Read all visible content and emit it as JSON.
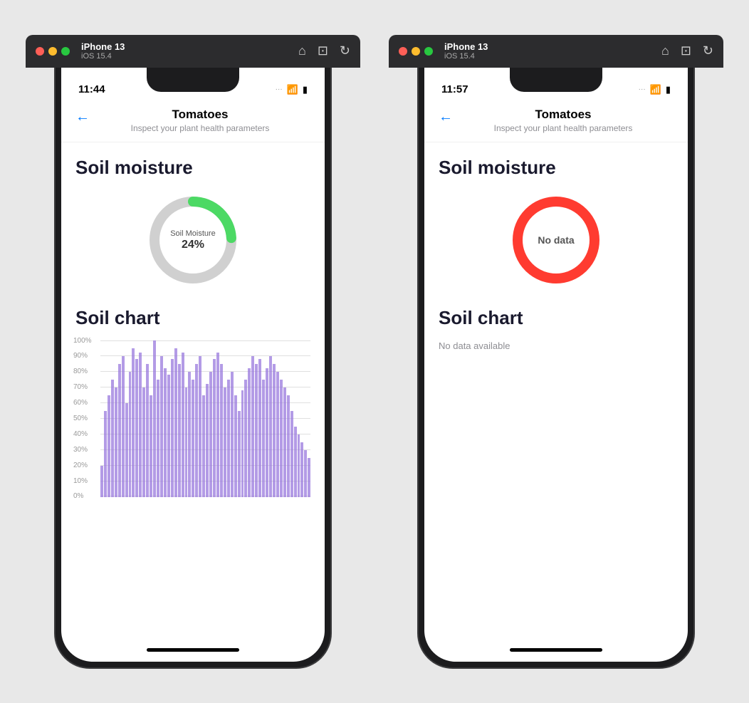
{
  "phone1": {
    "topbar": {
      "device_name": "iPhone 13",
      "device_os": "iOS 15.4",
      "home_label": "⌂",
      "screenshot_label": "⊡",
      "rotate_label": "↺"
    },
    "status": {
      "time": "11:44"
    },
    "nav": {
      "back_label": "←",
      "title": "Tomatoes",
      "subtitle": "Inspect your plant health parameters"
    },
    "soil_moisture": {
      "section_title": "Soil moisture",
      "donut_label": "Soil Moisture",
      "donut_value": "24%",
      "donut_percent": 24
    },
    "soil_chart": {
      "section_title": "Soil chart",
      "y_labels": [
        "100%",
        "90%",
        "80%",
        "70%",
        "60%",
        "50%",
        "40%",
        "30%",
        "20%",
        "10%",
        "0%"
      ],
      "bars": [
        20,
        55,
        65,
        75,
        70,
        85,
        90,
        60,
        80,
        95,
        88,
        92,
        70,
        85,
        65,
        100,
        75,
        90,
        82,
        78,
        88,
        95,
        85,
        92,
        70,
        80,
        75,
        85,
        90,
        65,
        72,
        80,
        88,
        92,
        85,
        70,
        75,
        80,
        65,
        55,
        68,
        75,
        82,
        90,
        85,
        88,
        75,
        82,
        90,
        85,
        80,
        75,
        70,
        65,
        55,
        45,
        40,
        35,
        30,
        25
      ]
    }
  },
  "phone2": {
    "topbar": {
      "device_name": "iPhone 13",
      "device_os": "iOS 15.4"
    },
    "status": {
      "time": "11:57"
    },
    "nav": {
      "back_label": "←",
      "title": "Tomatoes",
      "subtitle": "Inspect your plant health parameters"
    },
    "soil_moisture": {
      "section_title": "Soil moisture",
      "no_data_label": "No data"
    },
    "soil_chart": {
      "section_title": "Soil chart",
      "no_data_subtitle": "No data available"
    }
  }
}
